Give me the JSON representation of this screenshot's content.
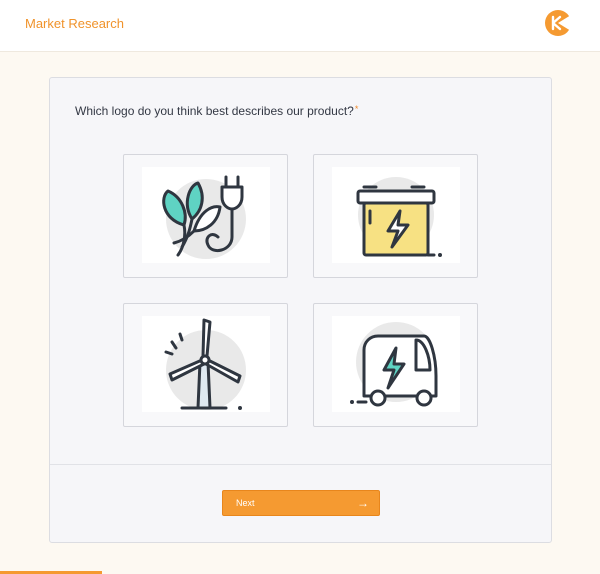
{
  "header": {
    "title": "Market Research",
    "logo_icon": "brand-logo-icon"
  },
  "survey": {
    "question": "Which logo do you think best describes our product?",
    "required_marker": "*",
    "options": [
      {
        "icon": "leaf-plug-icon"
      },
      {
        "icon": "battery-lightning-icon"
      },
      {
        "icon": "wind-turbine-icon"
      },
      {
        "icon": "electric-vehicle-icon"
      }
    ],
    "next_label": "Next",
    "next_arrow": "→"
  },
  "progress": {
    "fraction": 0.17
  },
  "colors": {
    "accent": "#f59a31",
    "teal": "#5fd3c3",
    "yellow": "#f7e183",
    "stroke": "#2f3640"
  }
}
